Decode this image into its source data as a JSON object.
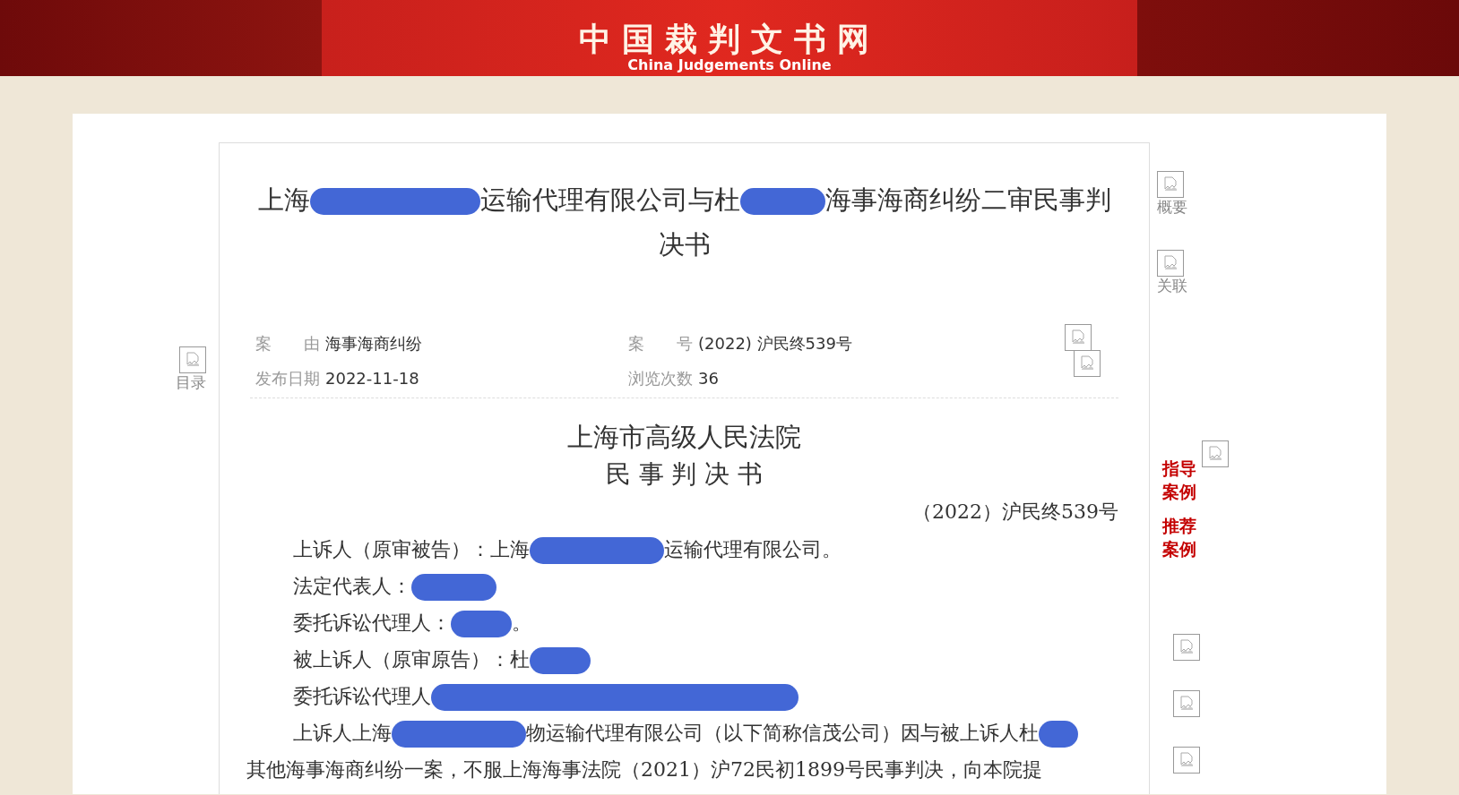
{
  "header": {
    "site_name": "中国裁判文书网",
    "site_name_en": "China Judgements Online"
  },
  "left_nav": [
    {
      "label": "目录"
    }
  ],
  "document": {
    "title_lines": [
      [
        {
          "kind": "text",
          "text": "上海"
        },
        {
          "kind": "redaction"
        },
        {
          "kind": "text",
          "text": "运输代理有限公司与杜"
        },
        {
          "kind": "redaction"
        },
        {
          "kind": "text",
          "text": "海事海商纠纷二审民事判"
        }
      ],
      [
        {
          "kind": "text",
          "text": "决书"
        }
      ]
    ],
    "meta": [
      {
        "label": "案　　由",
        "value": "海事海商纠纷"
      },
      {
        "label": "案　　号",
        "value": "(2022) 沪民终539号"
      },
      {
        "label": "发布日期",
        "value": "2022-11-18"
      },
      {
        "label": "浏览次数",
        "value": "36"
      }
    ],
    "court": "上海市高级人民法院",
    "doc_type": "民 事 判 决 书",
    "case_number": "（2022）沪民终539号",
    "lines": [
      {
        "kind": "first",
        "parts": [
          {
            "kind": "text",
            "text": "上诉人（原审被告）：上海"
          },
          {
            "kind": "redaction"
          },
          {
            "kind": "text",
            "text": "运输代理有限公司。"
          }
        ]
      },
      {
        "kind": "first",
        "parts": [
          {
            "kind": "text",
            "text": "法定代表人："
          },
          {
            "kind": "redaction"
          }
        ]
      },
      {
        "kind": "first",
        "parts": [
          {
            "kind": "text",
            "text": "委托诉讼代理人："
          },
          {
            "kind": "redaction"
          },
          {
            "kind": "text",
            "text": "。"
          }
        ]
      },
      {
        "kind": "first",
        "parts": [
          {
            "kind": "text",
            "text": "被上诉人（原审原告）：杜"
          },
          {
            "kind": "redaction"
          }
        ]
      },
      {
        "kind": "first",
        "parts": [
          {
            "kind": "text",
            "text": "委托诉讼代理人"
          },
          {
            "kind": "redaction"
          }
        ]
      },
      {
        "kind": "first",
        "parts": [
          {
            "kind": "text",
            "text": "上诉人上海"
          },
          {
            "kind": "redaction"
          },
          {
            "kind": "text",
            "text": "物运输代理有限公司（以下简称信茂公司）因与被上诉人杜"
          },
          {
            "kind": "redaction"
          }
        ]
      },
      {
        "kind": "continuation",
        "parts": [
          {
            "kind": "text",
            "text": "其他海事海商纠纷一案，不服上海海事法院（2021）沪72民初1899号民事判决，向本院提"
          }
        ]
      }
    ]
  },
  "right_nav": [
    {
      "kind": "icon_link",
      "label": "概要"
    },
    {
      "kind": "icon_link",
      "label": "关联"
    },
    {
      "kind": "red_link",
      "label": "指导案例",
      "icon": true
    },
    {
      "kind": "red_link",
      "label": "推荐案例",
      "icon": false
    },
    {
      "kind": "icon"
    },
    {
      "kind": "icon"
    },
    {
      "kind": "icon"
    }
  ]
}
